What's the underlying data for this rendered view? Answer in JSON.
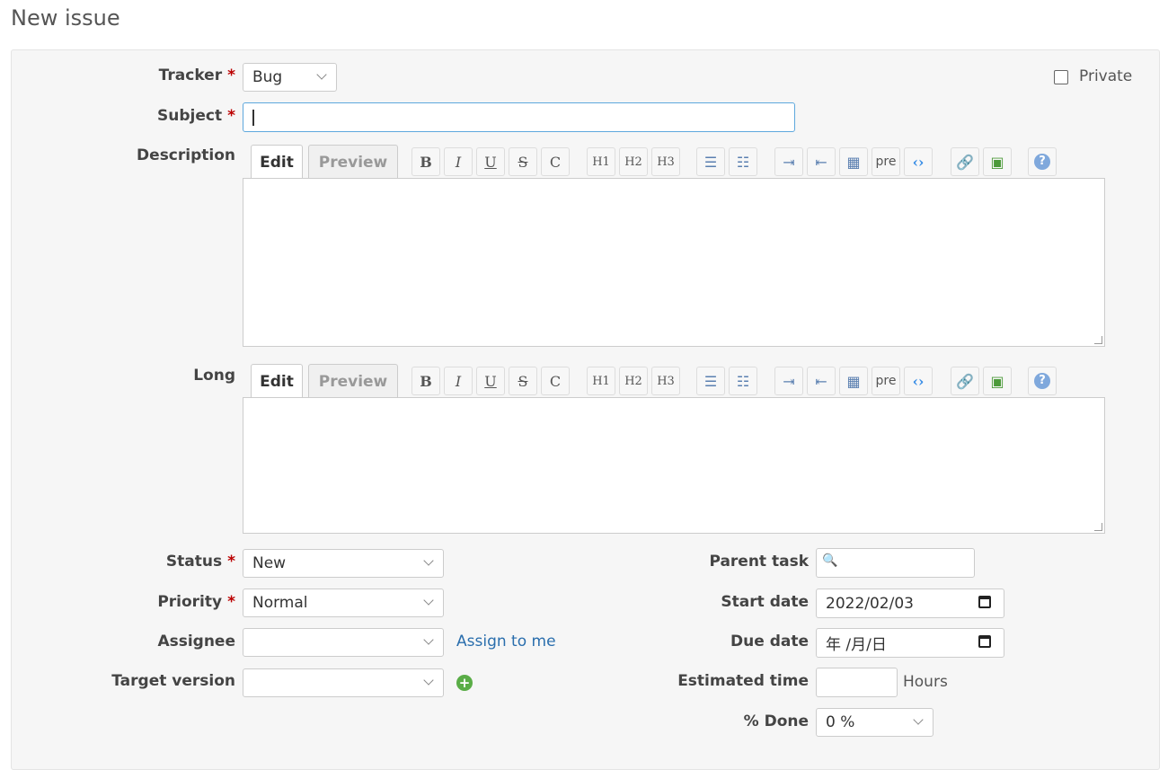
{
  "title": "New issue",
  "form": {
    "tracker": {
      "label": "Tracker",
      "value": "Bug"
    },
    "private": {
      "label": "Private",
      "checked": false
    },
    "subject": {
      "label": "Subject",
      "value": ""
    },
    "description": {
      "label": "Description"
    },
    "long": {
      "label": "Long"
    },
    "editor": {
      "edit_tab": "Edit",
      "preview_tab": "Preview",
      "toolbar": [
        {
          "name": "bold",
          "glyph": "B"
        },
        {
          "name": "italic",
          "glyph": "I"
        },
        {
          "name": "underline",
          "glyph": "U"
        },
        {
          "name": "strikethrough",
          "glyph": "S"
        },
        {
          "name": "inline-code",
          "glyph": "C"
        },
        {
          "name": "heading-1",
          "glyph": "H1"
        },
        {
          "name": "heading-2",
          "glyph": "H2"
        },
        {
          "name": "heading-3",
          "glyph": "H3"
        },
        {
          "name": "unordered-list",
          "glyph": "☰"
        },
        {
          "name": "ordered-list",
          "glyph": "☷"
        },
        {
          "name": "indent",
          "glyph": "⇥"
        },
        {
          "name": "outdent",
          "glyph": "⇤"
        },
        {
          "name": "table",
          "glyph": "▦"
        },
        {
          "name": "preformatted",
          "glyph": "pre"
        },
        {
          "name": "code-highlight",
          "glyph": "‹›"
        },
        {
          "name": "link-attachment",
          "glyph": "🔗"
        },
        {
          "name": "image",
          "glyph": "▣"
        },
        {
          "name": "help",
          "glyph": "?"
        }
      ]
    },
    "status": {
      "label": "Status",
      "value": "New"
    },
    "priority": {
      "label": "Priority",
      "value": "Normal"
    },
    "assignee": {
      "label": "Assignee",
      "value": "",
      "assign_to_me": "Assign to me"
    },
    "target_version": {
      "label": "Target version",
      "value": ""
    },
    "parent_task": {
      "label": "Parent task",
      "value": ""
    },
    "start_date": {
      "label": "Start date",
      "value": "2022/02/03"
    },
    "due_date": {
      "label": "Due date",
      "value": "年 /月/日"
    },
    "estimated_time": {
      "label": "Estimated time",
      "value": "",
      "unit": "Hours"
    },
    "done": {
      "label": "% Done",
      "value": "0 %"
    },
    "required_marker": "*"
  }
}
